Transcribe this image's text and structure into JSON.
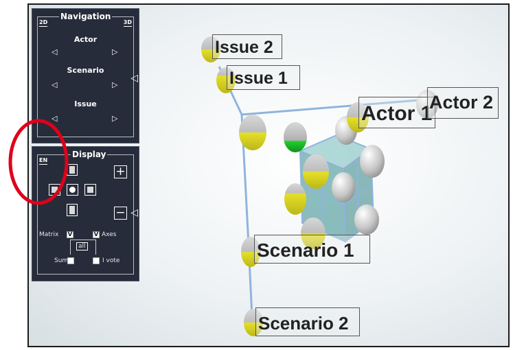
{
  "navigation": {
    "title": "Navigation",
    "mode_2d": "2D",
    "mode_3d": "3D",
    "rows": [
      {
        "label": "Actor"
      },
      {
        "label": "Scenario"
      },
      {
        "label": "Issue"
      }
    ],
    "arrow_left": "◁",
    "arrow_right": "▷",
    "side_arrow": "◁"
  },
  "display": {
    "title": "Display",
    "language": "EN",
    "plus": "+",
    "minus": "−",
    "side_arrow": "◁",
    "matrix_label": "Matrix",
    "axes_label": "Axes",
    "all_label": "all",
    "sum_label": "Sum",
    "vote_label": "I vote",
    "matrix_checked": true,
    "axes_checked": true,
    "check_mark": "V"
  },
  "scene_labels": [
    {
      "id": "issue2",
      "text": "Issue 2"
    },
    {
      "id": "issue1",
      "text": "Issue 1"
    },
    {
      "id": "actor1",
      "text": "Actor 1"
    },
    {
      "id": "actor2",
      "text": "Actor 2"
    },
    {
      "id": "scenario1",
      "text": "Scenario 1"
    },
    {
      "id": "scenario2",
      "text": "Scenario 2"
    }
  ],
  "colors": {
    "panel_bg": "#262c3a",
    "highlight_circle": "#e0001a",
    "cube_fill": "#5aa3a3",
    "axis_line": "#8fb4dc",
    "ball_yellow": "#e8e22a",
    "ball_green": "#22c430",
    "ball_grey": "#c2c2c2"
  }
}
